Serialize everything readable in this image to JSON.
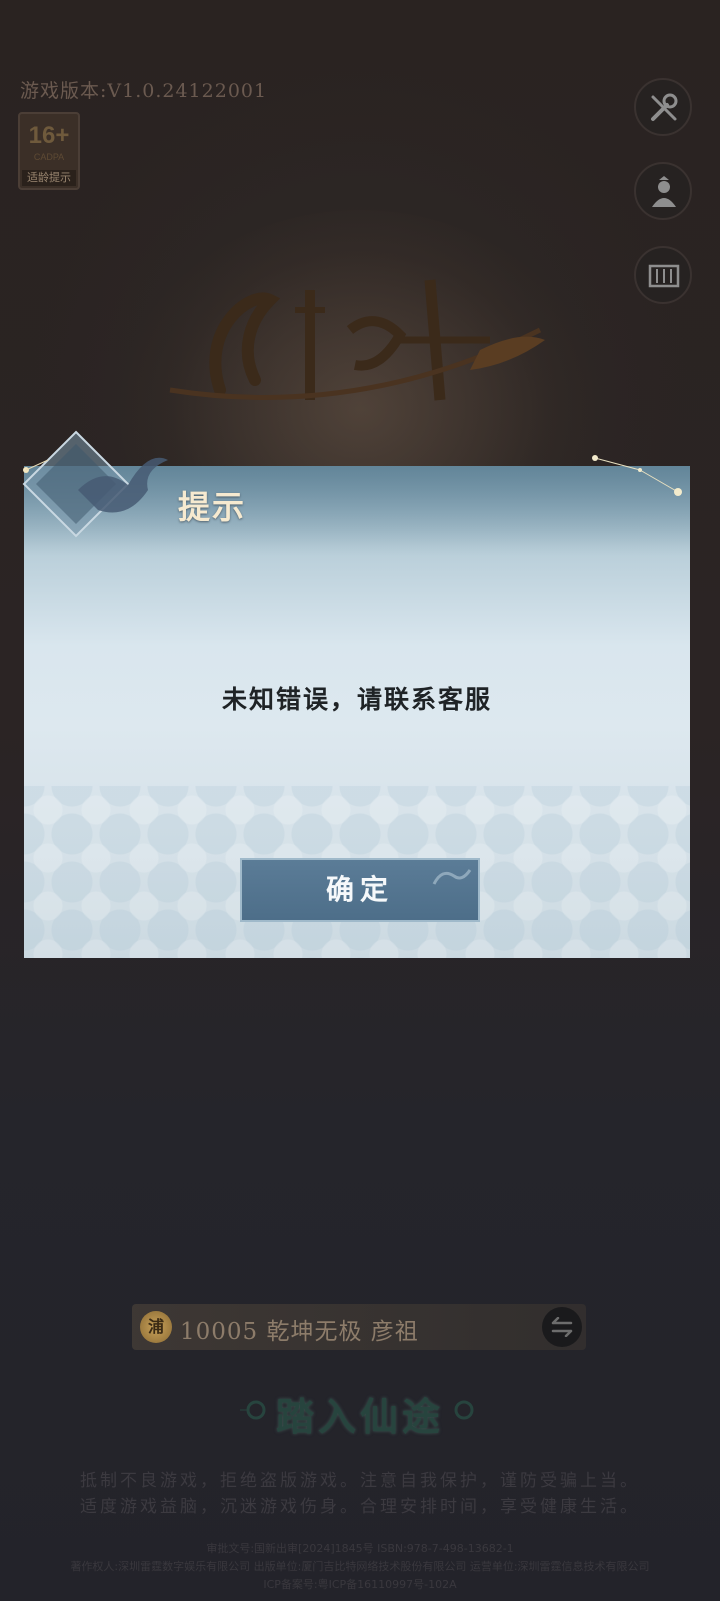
{
  "game": {
    "version_label": "游戏版本:V1.0.24122001",
    "age_rating": {
      "number": "16+",
      "sub": "CADPA",
      "label": "适龄提示"
    },
    "side_buttons": [
      "wrench-icon",
      "character-icon",
      "scroll-icon"
    ]
  },
  "dialog": {
    "title": "提示",
    "message": "未知错误，请联系客服",
    "confirm_label": "确定"
  },
  "server": {
    "icon_text": "浦",
    "text": "10005 乾坤无极  彦祖"
  },
  "enter": {
    "label": "踏入仙途"
  },
  "health_notice": {
    "line1": "抵制不良游戏，拒绝盗版游戏。注意自我保护，谨防受骗上当。",
    "line2": "适度游戏益脑，沉迷游戏伤身。合理安排时间，享受健康生活。"
  },
  "legal": {
    "line1": "审批文号:国新出审[2024]1845号 ISBN:978-7-498-13682-1",
    "line2": "著作权人:深圳雷霆数字娱乐有限公司 出版单位:厦门吉比特网络技术股份有限公司 运营单位:深圳雷霆信息技术有限公司",
    "line3": "ICP备案号:粤ICP备16110997号-102A"
  },
  "colors": {
    "background": "#1f1b1c",
    "dialog_top": "#7ea0b3",
    "dialog_body": "#dde8ef",
    "button": "#4d6e89",
    "title_text": "#f6ead0",
    "enter_text": "#27443e"
  }
}
